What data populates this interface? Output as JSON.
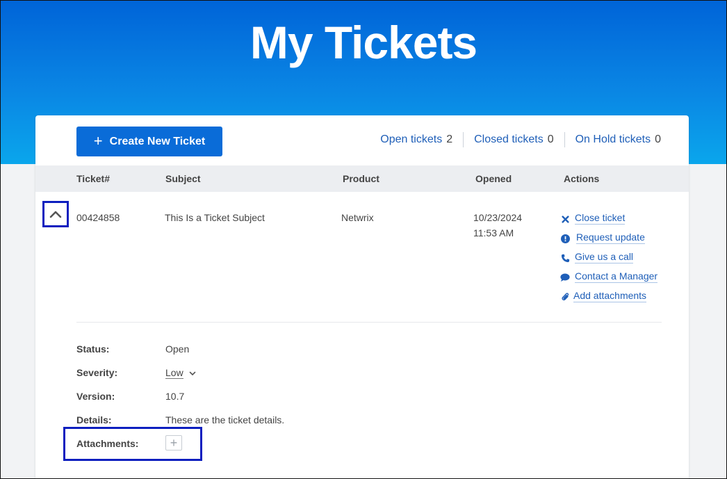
{
  "header": {
    "title": "My Tickets"
  },
  "toolbar": {
    "create_label": "Create New Ticket",
    "counts": [
      {
        "label": "Open tickets",
        "count": "2"
      },
      {
        "label": "Closed tickets",
        "count": "0"
      },
      {
        "label": "On Hold tickets",
        "count": "0"
      }
    ]
  },
  "table": {
    "columns": [
      "Ticket#",
      "Subject",
      "Product",
      "Opened",
      "Actions"
    ],
    "rows": [
      {
        "ticket": "00424858",
        "subject": "This Is a Ticket Subject",
        "product": "Netwrix",
        "opened_date": "10/23/2024",
        "opened_time": "11:53 AM",
        "actions": [
          {
            "label": "Close ticket",
            "icon": "close-icon"
          },
          {
            "label": "Request update",
            "icon": "alert-circle-icon"
          },
          {
            "label": "Give us a call",
            "icon": "phone-icon"
          },
          {
            "label": "Contact a Manager",
            "icon": "chat-bubble-icon"
          },
          {
            "label": "Add attachments",
            "icon": "paperclip-icon"
          }
        ]
      }
    ]
  },
  "details": {
    "status_label": "Status:",
    "status_value": "Open",
    "severity_label": "Severity:",
    "severity_value": "Low",
    "version_label": "Version:",
    "version_value": "10.7",
    "details_label": "Details:",
    "details_value": "These are the ticket details.",
    "attachments_label": "Attachments:"
  },
  "colors": {
    "accent": "#0a6cd8",
    "link": "#1f5fb8",
    "highlight": "#0d1fbf"
  }
}
